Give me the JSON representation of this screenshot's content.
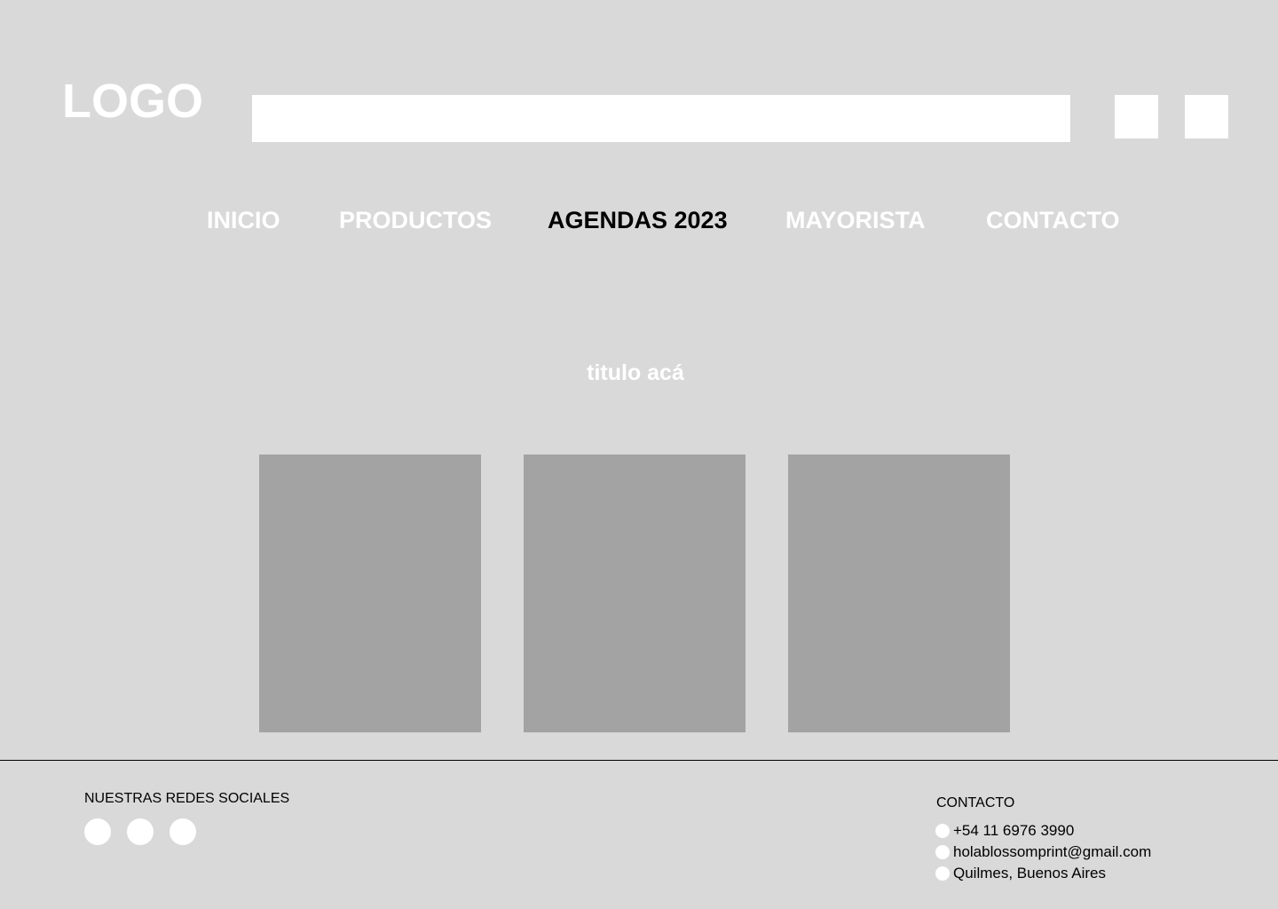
{
  "header": {
    "logo_text": "LOGO",
    "search": {
      "value": "",
      "placeholder": ""
    },
    "icon_buttons": [
      {
        "icon": "square-placeholder-icon"
      },
      {
        "icon": "square-placeholder-icon"
      }
    ]
  },
  "nav": {
    "items": [
      {
        "label": "INICIO",
        "active": false
      },
      {
        "label": "PRODUCTOS",
        "active": false
      },
      {
        "label": "AGENDAS 2023",
        "active": true
      },
      {
        "label": "MAYORISTA",
        "active": false
      },
      {
        "label": "CONTACTO",
        "active": false
      }
    ]
  },
  "main": {
    "title": "titulo acá",
    "cards": [
      {
        "image": "placeholder-image"
      },
      {
        "image": "placeholder-image"
      },
      {
        "image": "placeholder-image"
      }
    ]
  },
  "footer": {
    "social_title": "NUESTRAS REDES SOCIALES",
    "social_icons": [
      "social-icon",
      "social-icon",
      "social-icon"
    ],
    "contact_title": "CONTACTO",
    "contact_items": [
      {
        "icon": "phone-icon",
        "text": "+54 11 6976 3990"
      },
      {
        "icon": "email-icon",
        "text": "holablossomprint@gmail.com"
      },
      {
        "icon": "location-icon",
        "text": "Quilmes, Buenos Aires"
      }
    ]
  },
  "colors": {
    "background": "#d9d9d9",
    "white": "#ffffff",
    "card": "#a3a3a3",
    "text": "#000000"
  }
}
